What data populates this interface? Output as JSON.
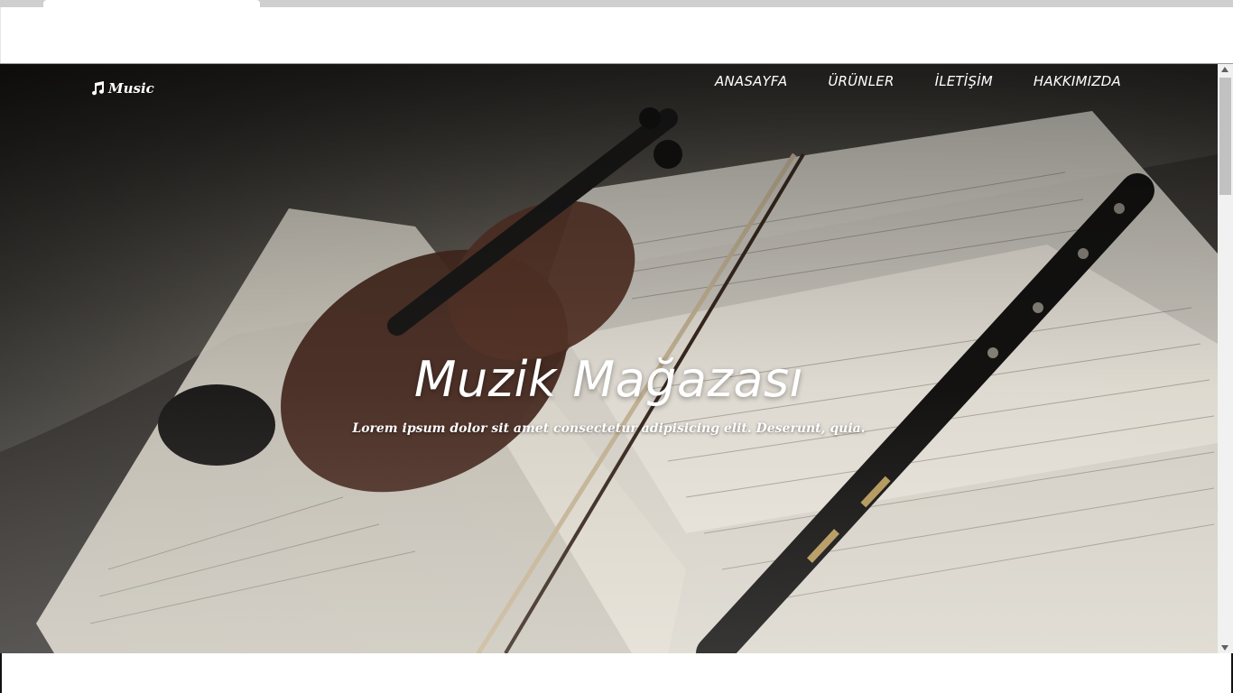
{
  "brand": {
    "icon": "music-note-icon",
    "name": "Music"
  },
  "nav": {
    "items": [
      {
        "label": "ANASAYFA"
      },
      {
        "label": "ÜRÜNLER"
      },
      {
        "label": "İLETİŞİM"
      },
      {
        "label": "HAKKIMIZDA"
      }
    ]
  },
  "hero": {
    "title": "Muzik Mağazası",
    "subtitle": "Lorem ipsum dolor sit amet consectetur adipisicing elit. Deserunt, quia.",
    "background_image": "violin-sheet-music-photo"
  },
  "colors": {
    "text": "#ffffff",
    "chrome": "#cfcfcf",
    "scrollbar_track": "#f1f1f1",
    "scrollbar_thumb": "#c1c1c1"
  }
}
